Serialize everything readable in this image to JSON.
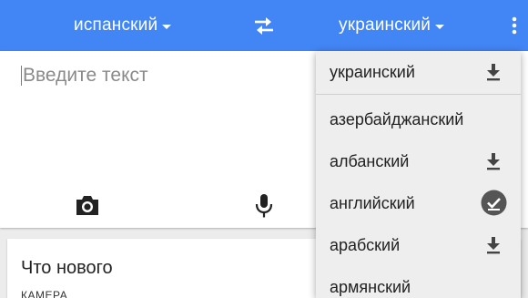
{
  "topbar": {
    "source_language": "испанский",
    "target_language": "украинский",
    "icons": {
      "swap": "swap-arrows-icon",
      "overflow": "more-vert-icon"
    }
  },
  "input": {
    "placeholder": "Введите текст",
    "icons": {
      "camera": "camera-icon",
      "mic": "microphone-icon"
    }
  },
  "news": {
    "title": "Что нового",
    "subtitle": "КАМЕРА"
  },
  "dropdown": {
    "selected": {
      "label": "украинский",
      "icon": "download-icon"
    },
    "items": [
      {
        "label": "азербайджанский",
        "icon": ""
      },
      {
        "label": "албанский",
        "icon": "download-icon"
      },
      {
        "label": "английский",
        "icon": "downloaded-check-icon"
      },
      {
        "label": "арабский",
        "icon": "download-icon"
      },
      {
        "label": "армянский",
        "icon": ""
      }
    ]
  },
  "colors": {
    "accent": "#4285f4",
    "background": "#ececec",
    "dropdown_bg": "#eeeeee",
    "icon_dark": "#444444"
  }
}
